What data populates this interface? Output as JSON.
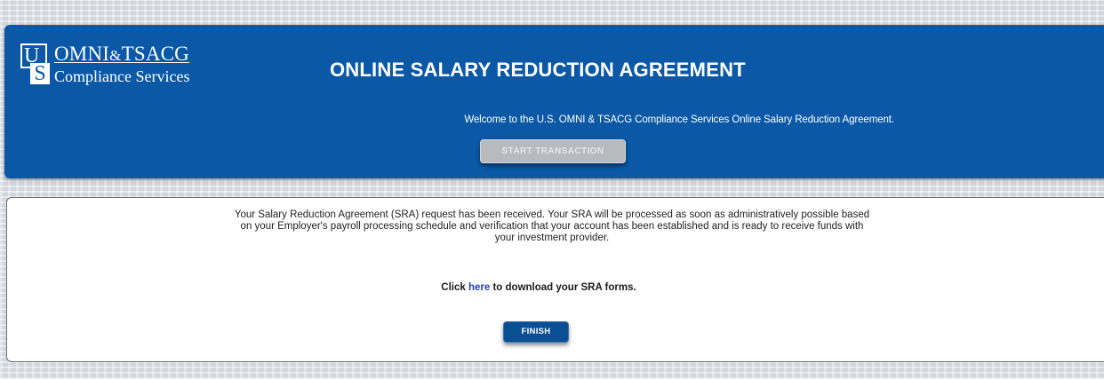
{
  "header": {
    "logo": {
      "mark_u": "U",
      "mark_s": "S",
      "line1_part1": "OMNI",
      "line1_amp": "&",
      "line1_part2": "TSACG",
      "line2": "Compliance Services"
    },
    "title": "ONLINE SALARY REDUCTION AGREEMENT",
    "welcome": "Welcome to the U.S. OMNI & TSACG Compliance Services Online Salary Reduction Agreement.",
    "start_button_label": "START TRANSACTION",
    "background_color": "#0a58a6"
  },
  "content": {
    "confirmation_lines": [
      "Your Salary Reduction Agreement (SRA) request has been received. Your SRA will be processed as soon as administratively possible based",
      "on your Employer's payroll processing schedule and verification that your account has been established and is ready to receive funds with",
      "your investment provider."
    ],
    "download_prefix": "Click ",
    "download_link_text": "here",
    "download_suffix": " to download your SRA forms.",
    "finish_button_label": "FINISH",
    "link_color": "#1f3fbf"
  }
}
